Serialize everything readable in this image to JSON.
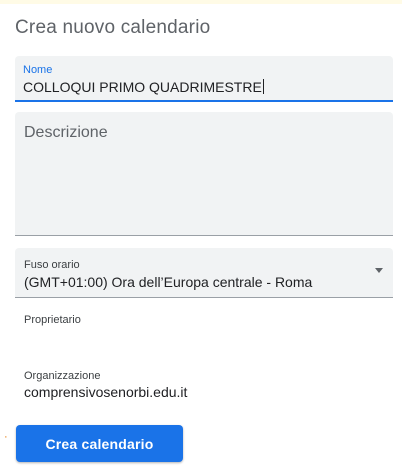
{
  "dialog": {
    "title": "Crea nuovo calendario"
  },
  "form": {
    "name": {
      "label": "Nome",
      "value": "COLLOQUI PRIMO QUADRIMESTRE"
    },
    "description": {
      "placeholder": "Descrizione",
      "value": ""
    },
    "timezone": {
      "label": "Fuso orario",
      "value": "(GMT+01:00) Ora dell’Europa centrale - Roma",
      "icon": "dropdown-arrow-icon"
    },
    "owner": {
      "label": "Proprietario"
    },
    "organization": {
      "label": "Organizzazione",
      "value": "comprensivosenorbi.edu.it"
    }
  },
  "actions": {
    "create_label": "Crea calendario"
  },
  "colors": {
    "accent": "#1a73e8",
    "field_bg": "#f1f3f4",
    "text": "#202124",
    "muted": "#5f6368"
  }
}
